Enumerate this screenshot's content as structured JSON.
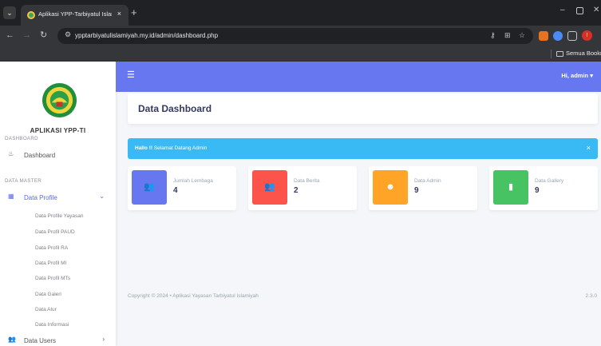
{
  "browser": {
    "tab_title": "Aplikasi YPP-Tarbiyatul Islamiya",
    "tab_close": "×",
    "new_tab": "+",
    "url": "ypptarbiyatulislamiyah.my.id/admin/dashboard.php",
    "bookmarks_label": "Semua Bookma"
  },
  "sidebar": {
    "brand": "APLIKASI YPP-TI",
    "heading_dashboard": "DASHBOARD",
    "dashboard_label": "Dashboard",
    "heading_master": "DATA MASTER",
    "data_profile_label": "Data Profile",
    "sub_items": [
      "Data Profile Yayasan",
      "Data Profil PAUD",
      "Data Profil RA",
      "Data Profil MI",
      "Data Profil MTs",
      "Data Galeri",
      "Data Alur",
      "Data Informasi"
    ],
    "data_users_label": "Data Users"
  },
  "topbar": {
    "user_label": "Hi, admin"
  },
  "main": {
    "page_title": "Data Dashboard",
    "alert": {
      "strong": "Hallo !!",
      "text": " Selamat Datang Admin",
      "close": "×"
    },
    "stats": [
      {
        "label": "Jumlah Lembaga",
        "value": "4",
        "color": "#6777ef",
        "icon": "users-icon"
      },
      {
        "label": "Data Berita",
        "value": "2",
        "color": "#fc544b",
        "icon": "users-icon"
      },
      {
        "label": "Data Admin",
        "value": "9",
        "color": "#ffa426",
        "icon": "user-circle-icon"
      },
      {
        "label": "Data Gallery",
        "value": "9",
        "color": "#47c363",
        "icon": "bookmark-icon"
      }
    ]
  },
  "footer": {
    "copyright": "Copyright © 2024",
    "separator": "•",
    "app_name": "Aplikasi Yayasan Tarbiyatul Islamiyah",
    "version": "2.3.0"
  }
}
